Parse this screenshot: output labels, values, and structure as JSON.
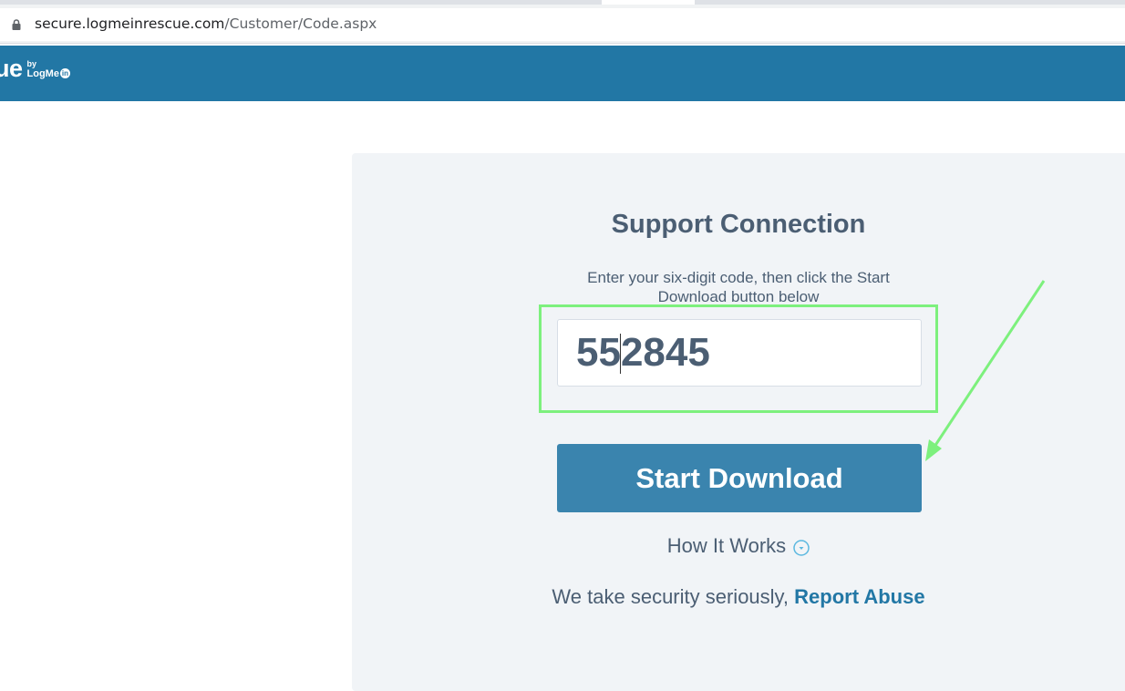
{
  "browser": {
    "url_host": "secure.logmeinrescue.com",
    "url_path": "/Customer/Code.aspx"
  },
  "header": {
    "logo_main": "ue",
    "logo_by": "by",
    "logo_brand": "LogMe",
    "logo_in": "in"
  },
  "main": {
    "title": "Support Connection",
    "instructions": "Enter your six-digit code, then click the Start Download button below",
    "code_value": "552845",
    "start_button_label": "Start Download",
    "how_it_works_label": "How It Works",
    "security_text": "We take security seriously, ",
    "report_abuse_label": "Report Abuse"
  },
  "colors": {
    "header_bg": "#2277a5",
    "button_bg": "#3a84ae",
    "text": "#4b5e73",
    "highlight": "#7df07d"
  }
}
